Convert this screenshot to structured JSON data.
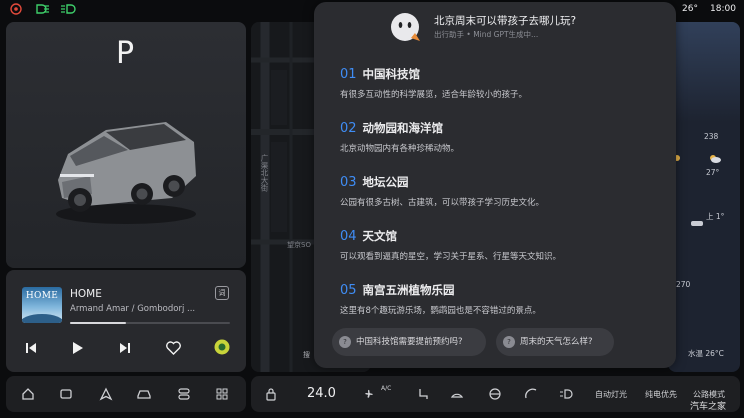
{
  "status_bar": {
    "outside_temp": "26°",
    "time": "18:00",
    "left_icons": [
      "seatbelt-warning-icon",
      "headlight-icon",
      "low-beam-icon"
    ]
  },
  "car": {
    "gear": "P"
  },
  "music": {
    "album_text": "HOME",
    "song_title": "HOME",
    "artist": "Armand Amar / Gombodorj ...",
    "lyric_label": "词",
    "progress": 0.35
  },
  "map": {
    "street_label": "广渠北大街",
    "partial_label": "望京SO",
    "search_label": "搜"
  },
  "weather": {
    "rows": [
      "238",
      "27°",
      "上 1°",
      "270",
      "水温 26°C"
    ]
  },
  "assistant": {
    "question": "北京周末可以带孩子去哪儿玩?",
    "source": "出行助手 • Mind GPT生成中...",
    "items": [
      {
        "num": "01",
        "title": "中国科技馆",
        "desc": "有很多互动性的科学展览，适合年龄较小的孩子。"
      },
      {
        "num": "02",
        "title": "动物园和海洋馆",
        "desc": "北京动物园内有各种珍稀动物。"
      },
      {
        "num": "03",
        "title": "地坛公园",
        "desc": "公园有很多古树、古建筑，可以带孩子学习历史文化。"
      },
      {
        "num": "04",
        "title": "天文馆",
        "desc": "可以观看到逼真的星空，学习关于星系、行星等天文知识。"
      },
      {
        "num": "05",
        "title": "南宫五洲植物乐园",
        "desc": "这里有8个趣玩游乐场，鹦鹉园也是不容错过的景点。"
      }
    ],
    "suggestions": [
      "中国科技馆需要提前预约吗?",
      "周末的天气怎么样?"
    ]
  },
  "dock": {
    "temperature": "24.0",
    "ac_label": "A/C",
    "auto_light": "自动灯光",
    "pure_power": "纯电优先",
    "highway_mode": "公路模式"
  },
  "watermark": "汽车之家",
  "colors": {
    "accent": "#3f8df5",
    "overlay_bg": "#2b2c30",
    "panel_bg": "#28292d"
  }
}
